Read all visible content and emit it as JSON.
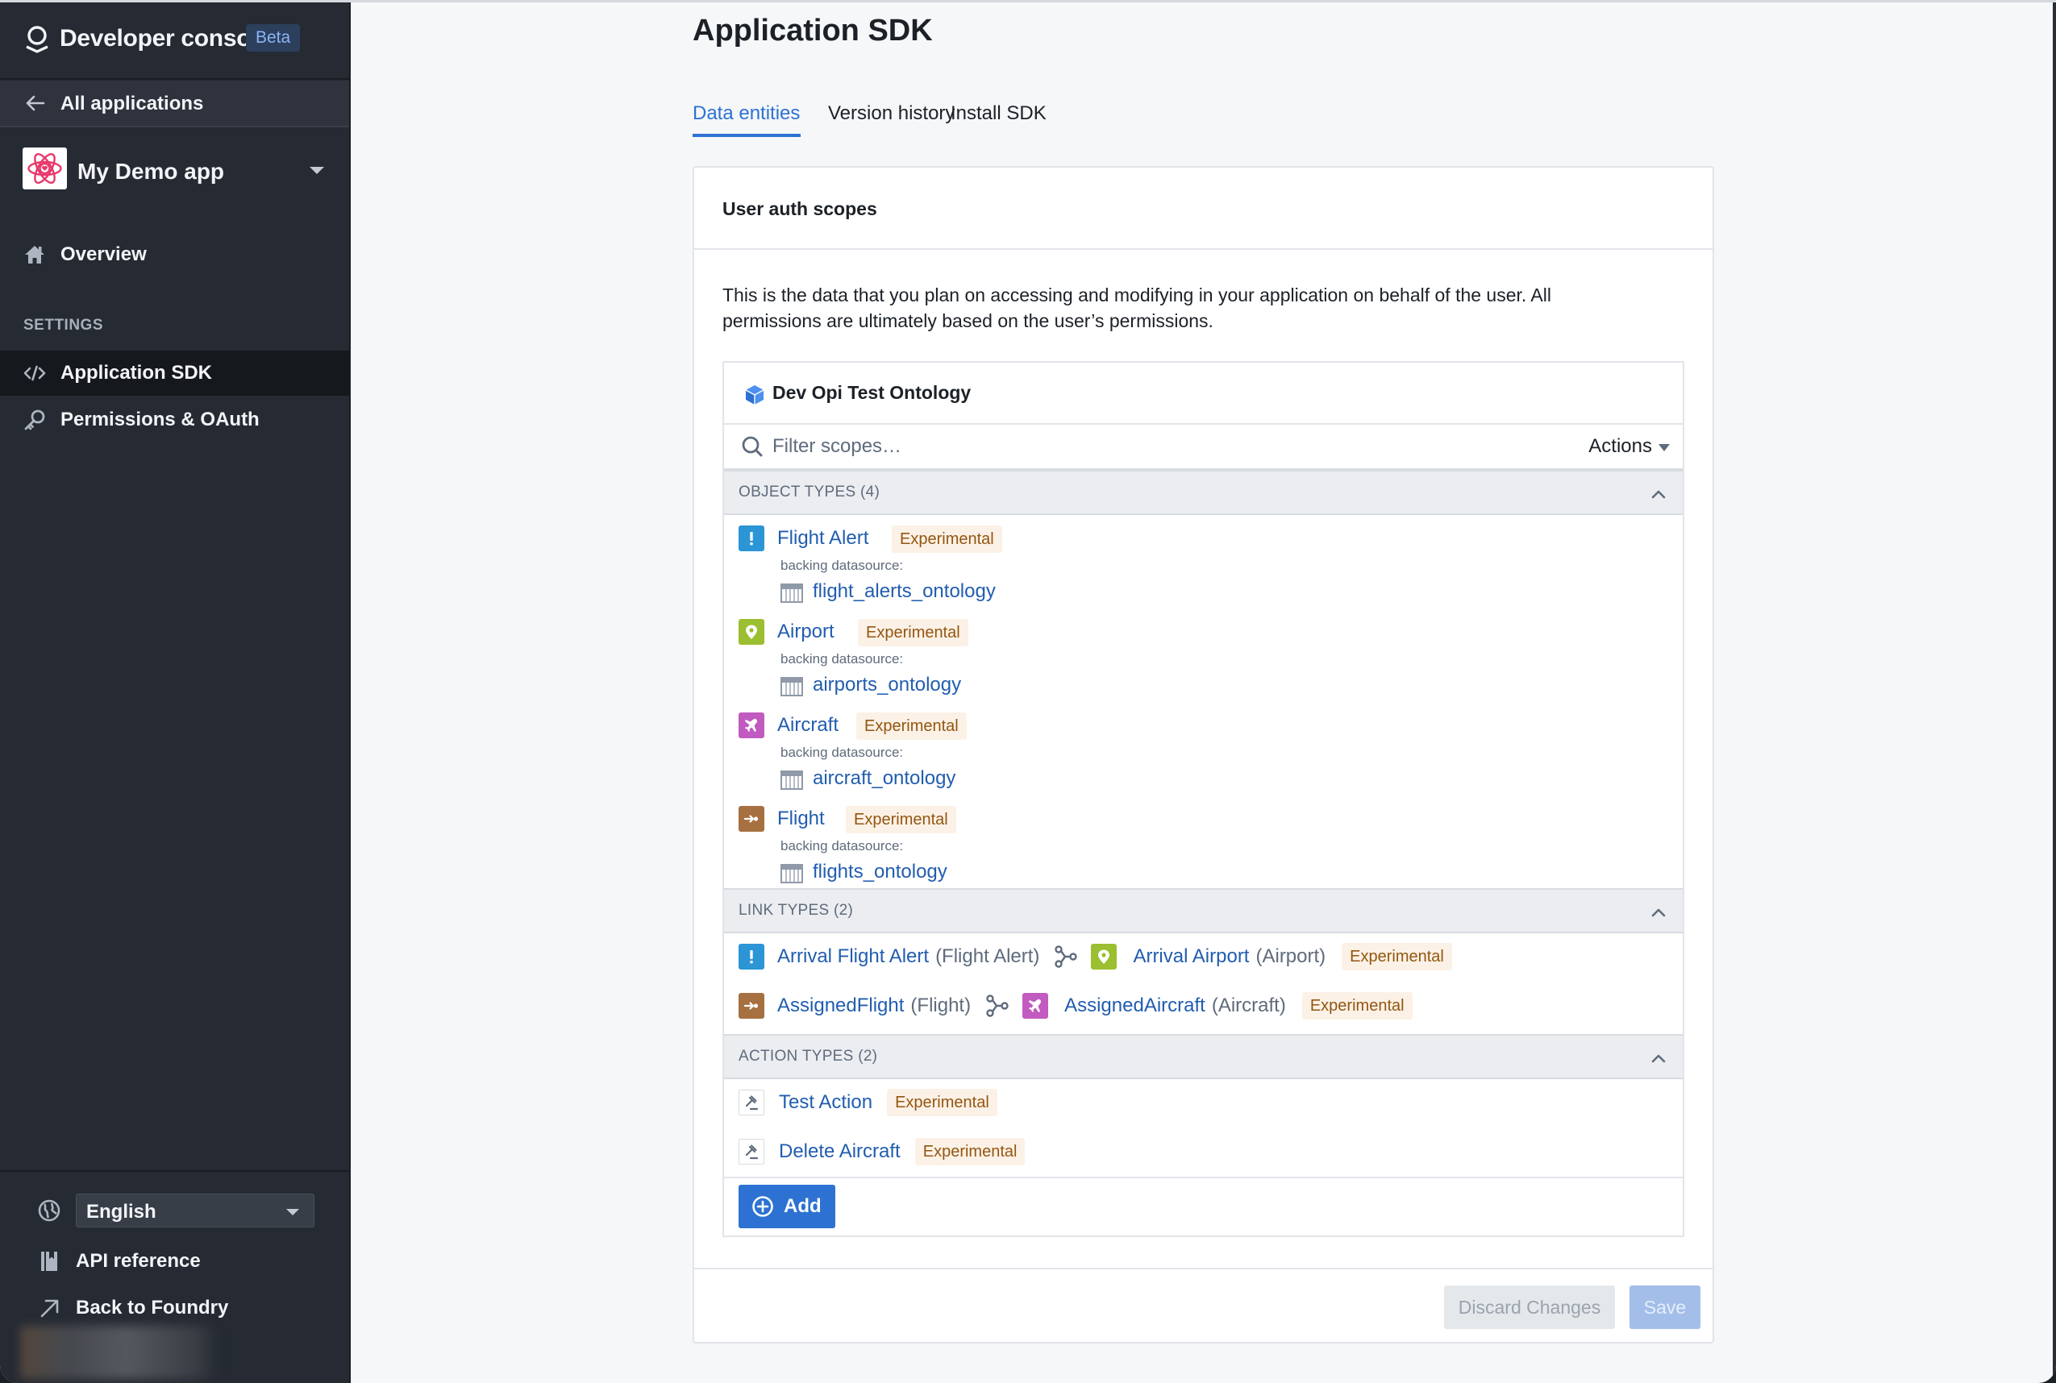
{
  "sidebar": {
    "brand": {
      "title": "Developer console",
      "badge": "Beta",
      "logo_icon": "palantir-logo-icon"
    },
    "back": {
      "label": "All applications",
      "icon": "arrow-left-icon"
    },
    "app": {
      "name": "My Demo app",
      "icon": "atom-heart-icon"
    },
    "nav": [
      {
        "label": "Overview",
        "icon": "home-icon",
        "active": false
      }
    ],
    "section_label": "SETTINGS",
    "settings": [
      {
        "label": "Application SDK",
        "icon": "code-icon",
        "active": true
      },
      {
        "label": "Permissions & OAuth",
        "icon": "key-icon",
        "active": false
      }
    ],
    "language": {
      "value": "English",
      "icon": "globe-icon"
    },
    "links": [
      {
        "label": "API reference",
        "icon": "book-icon"
      },
      {
        "label": "Back to Foundry",
        "icon": "arrow-top-right-icon"
      }
    ]
  },
  "main": {
    "title": "Application SDK",
    "tabs": [
      {
        "label": "Data entities",
        "active": true
      },
      {
        "label": "Version history",
        "active": false
      },
      {
        "label": "Install SDK",
        "active": false
      }
    ],
    "card": {
      "title": "User auth scopes",
      "description": "This is the data that you plan on accessing and modifying in your application on behalf of the user. All permissions are ultimately based on the user’s permissions.",
      "ontology": {
        "name": "Dev Opi Test Ontology",
        "icon": "cube-icon"
      },
      "filter": {
        "placeholder": "Filter scopes…",
        "value": ""
      },
      "actions_label": "Actions",
      "object_types": {
        "header": "OBJECT TYPES (4)",
        "items": [
          {
            "name": "Flight Alert",
            "badge": "Experimental",
            "backing_label": "backing datasource:",
            "datasource": "flight_alerts_ontology",
            "icon": "exclamation-icon",
            "color": "#2b95d6"
          },
          {
            "name": "Airport",
            "badge": "Experimental",
            "backing_label": "backing datasource:",
            "datasource": "airports_ontology",
            "icon": "map-marker-icon",
            "color": "#9bbf30"
          },
          {
            "name": "Aircraft",
            "badge": "Experimental",
            "backing_label": "backing datasource:",
            "datasource": "aircraft_ontology",
            "icon": "airplane-icon",
            "color": "#c15bc0"
          },
          {
            "name": "Flight",
            "badge": "Experimental",
            "backing_label": "backing datasource:",
            "datasource": "flights_ontology",
            "icon": "flight-arrow-icon",
            "color": "#a67041"
          }
        ]
      },
      "link_types": {
        "header": "LINK TYPES (2)",
        "items": [
          {
            "from_name": "Arrival Flight Alert",
            "from_type": "(Flight Alert)",
            "from_icon": "exclamation-icon",
            "from_color": "#2b95d6",
            "to_name": "Arrival Airport",
            "to_type": "(Airport)",
            "to_icon": "map-marker-icon",
            "to_color": "#9bbf30",
            "badge": "Experimental"
          },
          {
            "from_name": "AssignedFlight",
            "from_type": "(Flight)",
            "from_icon": "flight-arrow-icon",
            "from_color": "#a67041",
            "to_name": "AssignedAircraft",
            "to_type": "(Aircraft)",
            "to_icon": "airplane-icon",
            "to_color": "#c15bc0",
            "badge": "Experimental"
          }
        ]
      },
      "action_types": {
        "header": "ACTION TYPES (2)",
        "items": [
          {
            "name": "Test Action",
            "badge": "Experimental",
            "icon": "gavel-icon"
          },
          {
            "name": "Delete Aircraft",
            "badge": "Experimental",
            "icon": "gavel-icon"
          }
        ]
      },
      "add_label": "Add",
      "discard_label": "Discard Changes",
      "save_label": "Save"
    }
  },
  "colors": {
    "accent": "#2d72d2",
    "link": "#215db0",
    "sidebar_bg": "#252a33",
    "badge_text": "#935610",
    "badge_bg": "#fcf1e6"
  }
}
